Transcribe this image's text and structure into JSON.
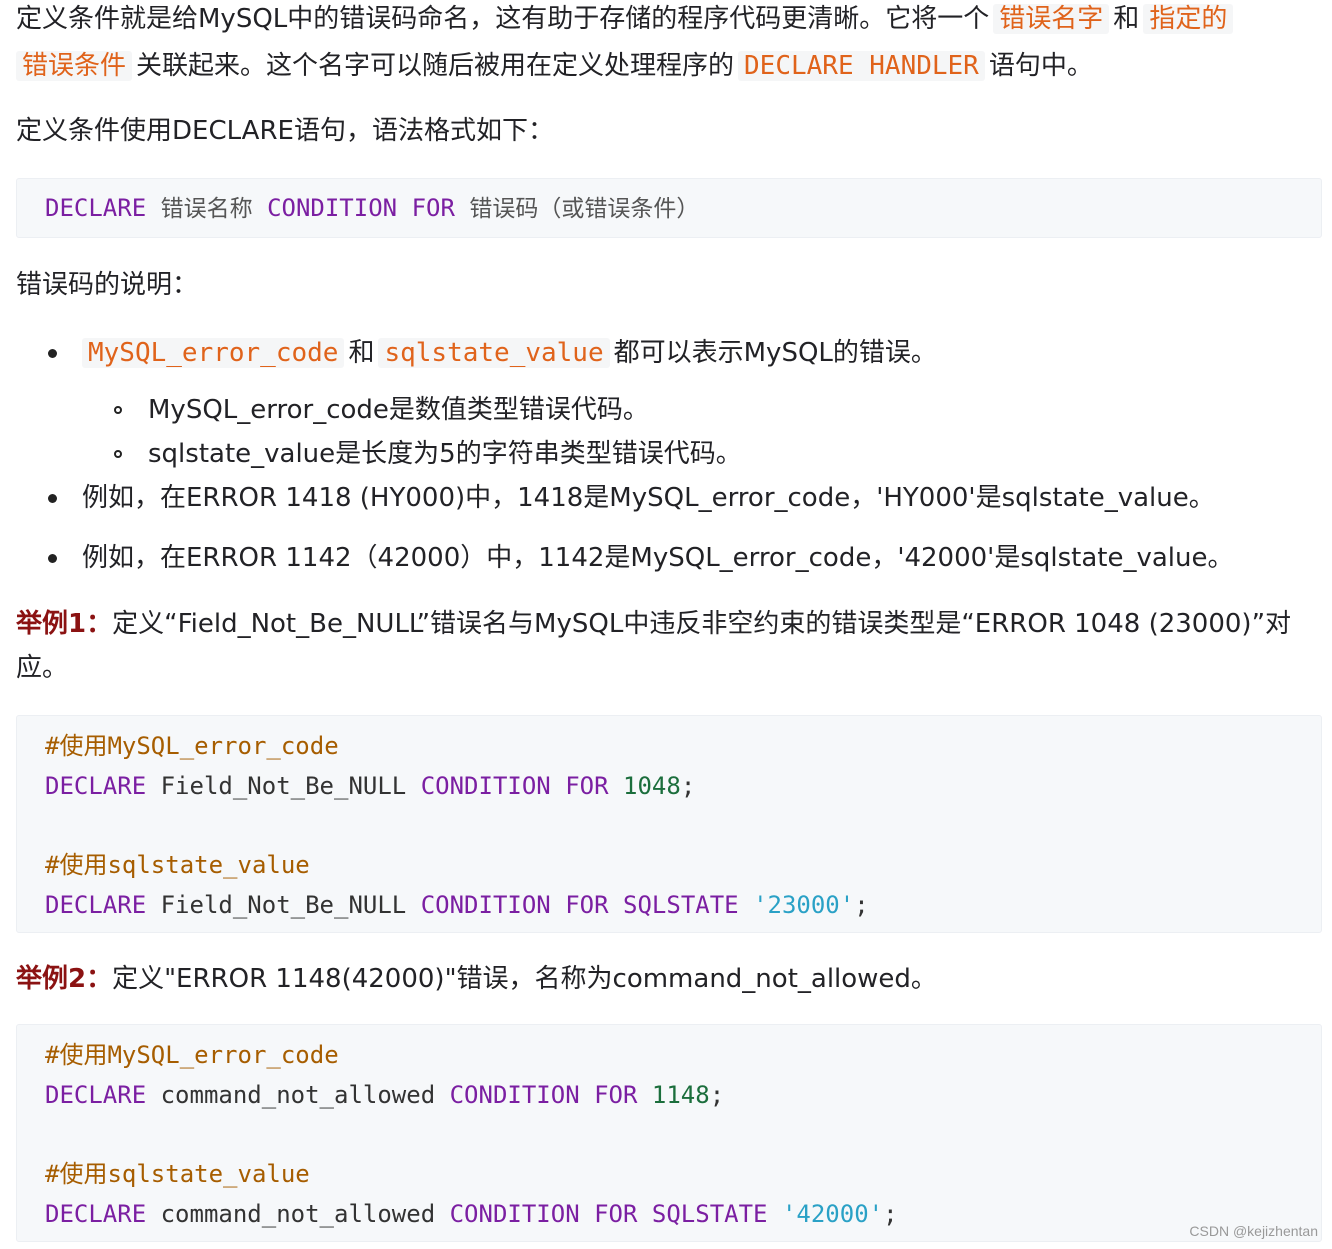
{
  "p1": {
    "text_a": "定义条件就是给MySQL中的错误码命名，这有助于存储的程序代码更清晰。它将一个",
    "code_a": "错误名字",
    "text_b": "和",
    "code_b": "指定的",
    "code_c": "错误条件",
    "text_c": "关联起来。这个名字可以随后被用在定义处理程序的",
    "code_d": "DECLARE HANDLER",
    "text_d": "语句中。"
  },
  "p2": "定义条件使用DECLARE语句，语法格式如下：",
  "syntax": {
    "kw1": "DECLARE",
    "cn1": "错误名称",
    "kw2": "CONDITION",
    "kw3": "FOR",
    "cn2": "错误码（或错误条件）"
  },
  "p3": "错误码的说明：",
  "bullets": {
    "b1": {
      "code1": "MySQL_error_code",
      "mid": "和",
      "code2": "sqlstate_value",
      "tail": "都可以表示MySQL的错误。"
    },
    "sub1": "MySQL_error_code是数值类型错误代码。",
    "sub2": "sqlstate_value是长度为5的字符串类型错误代码。",
    "b2": "例如，在ERROR 1418 (HY000)中，1418是MySQL_error_code，'HY000'是sqlstate_value。",
    "b3": "例如，在ERROR 1142（42000）中，1142是MySQL_error_code，'42000'是sqlstate_value。"
  },
  "example1": {
    "label": "举例1：",
    "text": "定义“Field_Not_Be_NULL”错误名与MySQL中违反非空约束的错误类型是“ERROR 1048 (23000)”对",
    "text2": "应。",
    "code": {
      "c1_hash": "#",
      "c1_cn": "使用",
      "c1_rest": "MySQL_error_code",
      "l2_kw1": "DECLARE",
      "l2_name": " Field_Not_Be_NULL ",
      "l2_kw2": "CONDITION",
      "l2_kw3": "FOR",
      "l2_num": "1048",
      "l2_end": ";",
      "c2_hash": "#",
      "c2_cn": "使用",
      "c2_rest": "sqlstate_value",
      "l4_kw1": "DECLARE",
      "l4_name": " Field_Not_Be_NULL ",
      "l4_kw2": "CONDITION",
      "l4_kw3": "FOR",
      "l4_kw4": "SQLSTATE",
      "l4_str": "'23000'",
      "l4_end": ";"
    }
  },
  "example2": {
    "label": "举例2：",
    "text": "定义\"ERROR 1148(42000)\"错误，名称为command_not_allowed。",
    "code": {
      "c1_hash": "#",
      "c1_cn": "使用",
      "c1_rest": "MySQL_error_code",
      "l2_kw1": "DECLARE",
      "l2_name": " command_not_allowed ",
      "l2_kw2": "CONDITION",
      "l2_kw3": "FOR",
      "l2_num": "1148",
      "l2_end": ";",
      "c2_hash": "#",
      "c2_cn": "使用",
      "c2_rest": "sqlstate_value",
      "l4_kw1": "DECLARE",
      "l4_name": " command_not_allowed ",
      "l4_kw2": "CONDITION",
      "l4_kw3": "FOR",
      "l4_kw4": "SQLSTATE",
      "l4_str": "'42000'",
      "l4_end": ";"
    }
  },
  "watermark": "CSDN @kejizhentan"
}
